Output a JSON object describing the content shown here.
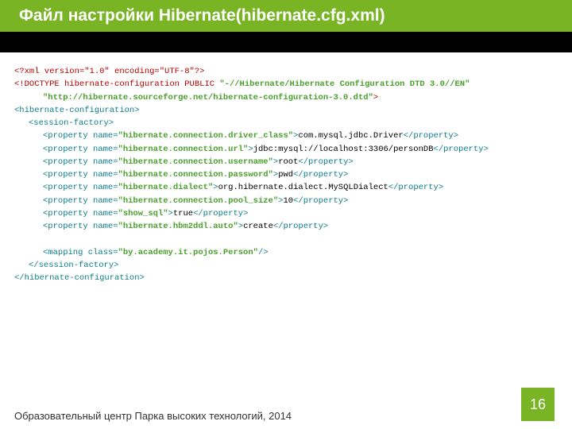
{
  "header": {
    "title_prefix": "Файл настройки Hibernate ",
    "paren_open": "(",
    "filename": "hibernate.cfg.xml",
    "paren_close": ")"
  },
  "code": {
    "l01": "<?xml version=\"1.0\" encoding=\"UTF-8\"?>",
    "l02a": "<!DOCTYPE hibernate-configuration PUBLIC ",
    "l02b": "\"-//Hibernate/Hibernate Configuration DTD 3.0//EN\"",
    "l03": "\"http://hibernate.sourceforge.net/hibernate-configuration-3.0.dtd\"",
    "l03end": ">",
    "l04o": "<hibernate-configuration>",
    "l05o": "<session-factory>",
    "prop_open": "<property ",
    "name_attr": "name=",
    "prop_close_open": ">",
    "prop_close": "</property>",
    "p1_name": "\"hibernate.connection.driver_class\"",
    "p1_val": "com.mysql.jdbc.Driver",
    "p2_name": "\"hibernate.connection.url\"",
    "p2_val": "jdbc:mysql://localhost:3306/personDB",
    "p3_name": "\"hibernate.connection.username\"",
    "p3_val": "root",
    "p4_name": "\"hibernate.connection.password\"",
    "p4_val": "pwd",
    "p5_name": "\"hibernate.dialect\"",
    "p5_val": "org.hibernate.dialect.MySQLDialect",
    "p6_name": "\"hibernate.connection.pool_size\"",
    "p6_val": "10",
    "p7_name": "\"show_sql\"",
    "p7_val": "true",
    "p8_name": "\"hibernate.hbm2ddl.auto\"",
    "p8_val": "create",
    "map_open": "<mapping ",
    "map_attr": "class=",
    "map_val": "\"by.academy.it.pojos.Person\"",
    "map_close": "/>",
    "l05c": "</session-factory>",
    "l04c": "</hibernate-configuration>"
  },
  "footer": {
    "text": "Образовательный центр Парка высоких технологий, 2014",
    "page": "16"
  }
}
